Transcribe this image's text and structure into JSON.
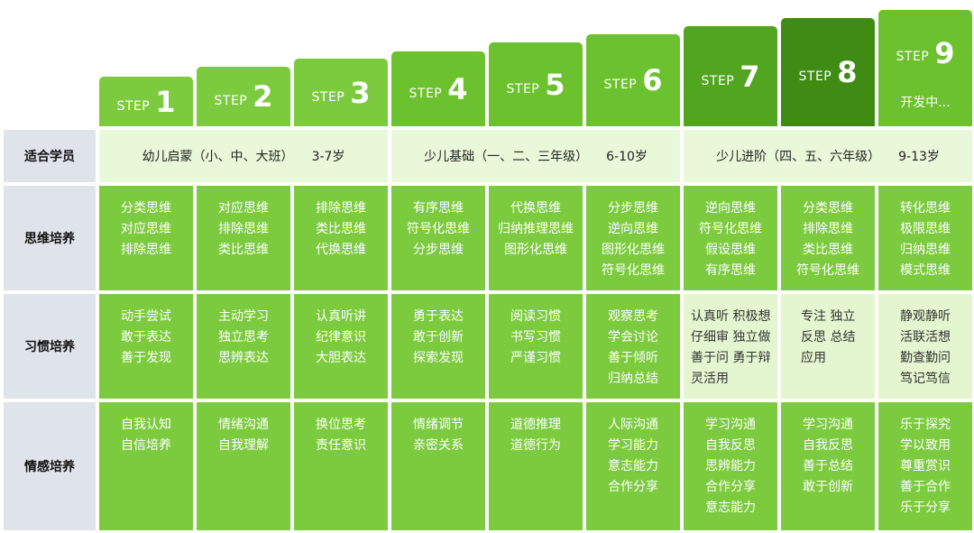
{
  "steps": [
    {
      "label": "STEP",
      "num": "1",
      "color": "#7ccb3f"
    },
    {
      "label": "STEP",
      "num": "2",
      "color": "#7ccb3f"
    },
    {
      "label": "STEP",
      "num": "3",
      "color": "#7ccb3f"
    },
    {
      "label": "STEP",
      "num": "4",
      "color": "#6cc12e"
    },
    {
      "label": "STEP",
      "num": "5",
      "color": "#6cc12e"
    },
    {
      "label": "STEP",
      "num": "6",
      "color": "#6cc12e"
    },
    {
      "label": "STEP",
      "num": "7",
      "color": "#52a61f"
    },
    {
      "label": "STEP",
      "num": "8",
      "color": "#3f8b14"
    },
    {
      "label": "STEP",
      "num": "9",
      "color": "#6cc12e",
      "note": "开发中..."
    }
  ],
  "row_headers": [
    "适合学员",
    "思维培养",
    "习惯培养",
    "情感培养"
  ],
  "groups": [
    {
      "name": "幼儿启蒙（小、中、大班）",
      "age": "3-7岁"
    },
    {
      "name": "少儿基础（一、二、三年级）",
      "age": "6-10岁"
    },
    {
      "name": "少儿进阶（四、五、六年级）",
      "age": "9-13岁"
    }
  ],
  "thinking": [
    [
      "分类思维",
      "对应思维",
      "排除思维"
    ],
    [
      "对应思维",
      "排除思维",
      "类比思维"
    ],
    [
      "排除思维",
      "类比思维",
      "代换思维"
    ],
    [
      "有序思维",
      "符号化思维",
      "分步思维"
    ],
    [
      "代换思维",
      "归纳推理思维",
      "图形化思维"
    ],
    [
      "分步思维",
      "逆向思维",
      "图形化思维",
      "符号化思维"
    ],
    [
      "逆向思维",
      "符号化思维",
      "假设思维",
      "有序思维"
    ],
    [
      "分类思维",
      "排除思维",
      "类比思维",
      "符号化思维"
    ],
    [
      "转化思维",
      "极限思维",
      "归纳思维",
      "模式思维"
    ]
  ],
  "habits": [
    [
      "动手尝试",
      "敢于表达",
      "善于发现"
    ],
    [
      "主动学习",
      "独立思考",
      "思辨表达"
    ],
    [
      "认真听讲",
      "纪律意识",
      "大胆表达"
    ],
    [
      "勇于表达",
      "敢于创新",
      "探索发现"
    ],
    [
      "阅读习惯",
      "书写习惯",
      "严谨习惯"
    ],
    [
      "观察思考",
      "学会讨论",
      "善于倾听",
      "归纳总结"
    ],
    [
      "认真听 积极想",
      "仔细审 独立做",
      "善于问 勇于辩",
      "灵活用"
    ],
    [
      "专注 独立",
      "反思 总结",
      "应用"
    ],
    [
      "静观静听",
      "活联活想",
      "勤查勤问",
      "笃记笃信"
    ]
  ],
  "emotion": [
    [
      "自我认知",
      "自信培养"
    ],
    [
      "情绪沟通",
      "自我理解"
    ],
    [
      "换位思考",
      "责任意识"
    ],
    [
      "情绪调节",
      "亲密关系"
    ],
    [
      "道德推理",
      "道德行为"
    ],
    [
      "人际沟通",
      "学习能力",
      "意志能力",
      "合作分享"
    ],
    [
      "学习沟通",
      "自我反思",
      "思辨能力",
      "合作分享",
      "意志能力"
    ],
    [
      "学习沟通",
      "自我反思",
      "善于总结",
      "敢于创新"
    ],
    [
      "乐于探究",
      "学以致用",
      "尊重赏识",
      "善于合作",
      "乐于分享"
    ]
  ]
}
